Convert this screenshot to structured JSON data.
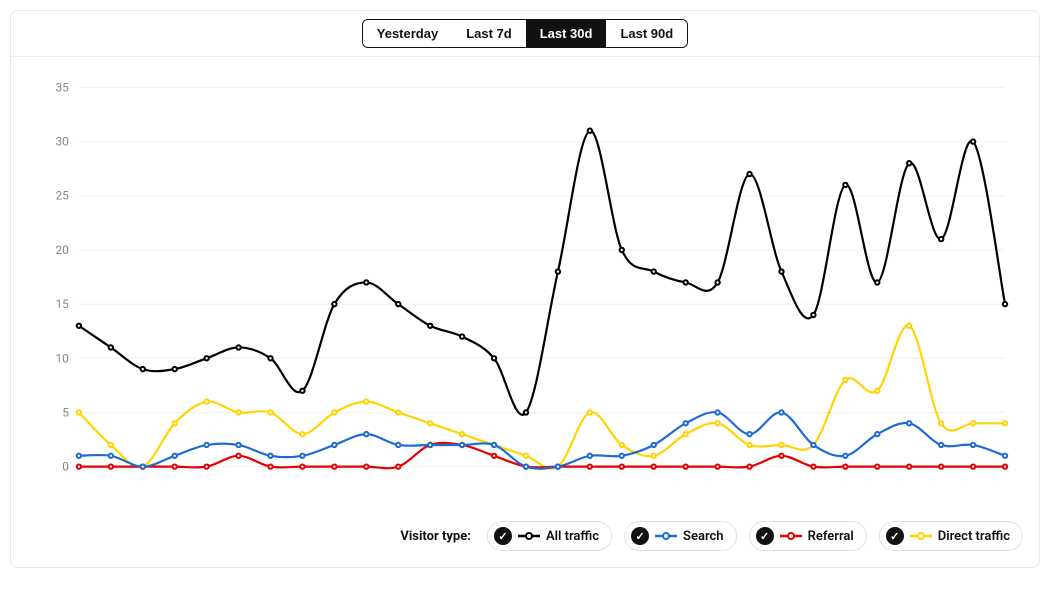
{
  "period_selector": {
    "options": [
      "Yesterday",
      "Last 7d",
      "Last 30d",
      "Last 90d"
    ],
    "active_index": 2
  },
  "legend": {
    "title": "Visitor type:",
    "items": [
      {
        "key": "all",
        "label": "All traffic",
        "color": "#000000",
        "checked": true
      },
      {
        "key": "search",
        "label": "Search",
        "color": "#1e6bd6",
        "checked": true
      },
      {
        "key": "referral",
        "label": "Referral",
        "color": "#e60000",
        "checked": true
      },
      {
        "key": "direct",
        "label": "Direct traffic",
        "color": "#ffd400",
        "checked": true
      }
    ]
  },
  "chart_data": {
    "type": "line",
    "title": "",
    "xlabel": "",
    "ylabel": "",
    "ylim": [
      0,
      35
    ],
    "yticks": [
      0,
      5,
      10,
      15,
      20,
      25,
      30,
      35
    ],
    "x": [
      1,
      2,
      3,
      4,
      5,
      6,
      7,
      8,
      9,
      10,
      11,
      12,
      13,
      14,
      15,
      16,
      17,
      18,
      19,
      20,
      21,
      22,
      23,
      24,
      25,
      26,
      27,
      28,
      29,
      30
    ],
    "series": [
      {
        "name": "All traffic",
        "color": "#000000",
        "values": [
          13,
          11,
          9,
          9,
          10,
          11,
          10,
          7,
          15,
          17,
          15,
          13,
          12,
          10,
          5,
          18,
          31,
          20,
          18,
          17,
          17,
          27,
          18,
          14,
          26,
          17,
          28,
          21,
          30,
          15
        ]
      },
      {
        "name": "Search",
        "color": "#1e6bd6",
        "values": [
          1,
          1,
          0,
          1,
          2,
          2,
          1,
          1,
          2,
          3,
          2,
          2,
          2,
          2,
          0,
          0,
          1,
          1,
          2,
          4,
          5,
          3,
          5,
          2,
          1,
          3,
          4,
          2,
          2,
          1
        ]
      },
      {
        "name": "Referral",
        "color": "#e60000",
        "values": [
          0,
          0,
          0,
          0,
          0,
          1,
          0,
          0,
          0,
          0,
          0,
          2,
          2,
          1,
          0,
          0,
          0,
          0,
          0,
          0,
          0,
          0,
          1,
          0,
          0,
          0,
          0,
          0,
          0,
          0
        ]
      },
      {
        "name": "Direct traffic",
        "color": "#ffd400",
        "values": [
          5,
          2,
          0,
          4,
          6,
          5,
          5,
          3,
          5,
          6,
          5,
          4,
          3,
          2,
          1,
          0,
          5,
          2,
          1,
          3,
          4,
          2,
          2,
          2,
          8,
          7,
          13,
          4,
          4,
          4
        ]
      }
    ]
  }
}
